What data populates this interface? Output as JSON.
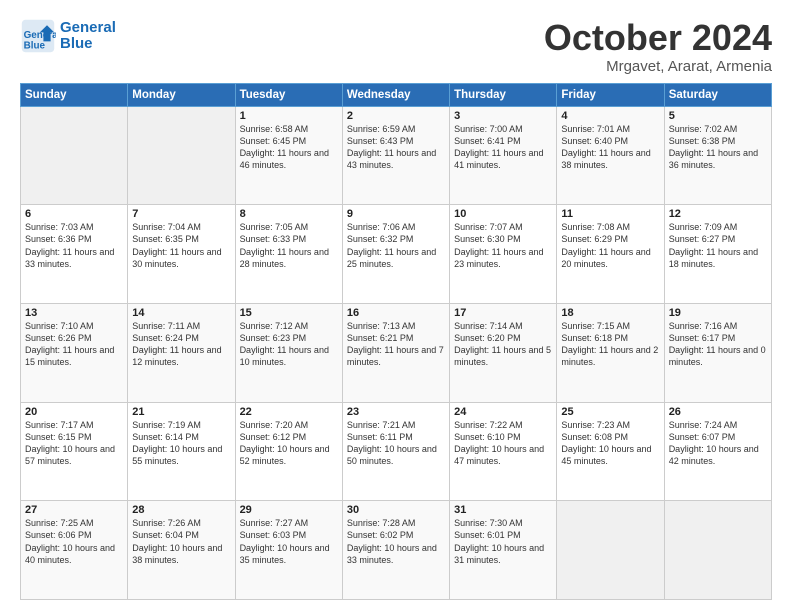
{
  "header": {
    "logo_line1": "General",
    "logo_line2": "Blue",
    "month": "October 2024",
    "location": "Mrgavet, Ararat, Armenia"
  },
  "weekdays": [
    "Sunday",
    "Monday",
    "Tuesday",
    "Wednesday",
    "Thursday",
    "Friday",
    "Saturday"
  ],
  "weeks": [
    [
      {
        "day": "",
        "sunrise": "",
        "sunset": "",
        "daylight": ""
      },
      {
        "day": "",
        "sunrise": "",
        "sunset": "",
        "daylight": ""
      },
      {
        "day": "1",
        "sunrise": "Sunrise: 6:58 AM",
        "sunset": "Sunset: 6:45 PM",
        "daylight": "Daylight: 11 hours and 46 minutes."
      },
      {
        "day": "2",
        "sunrise": "Sunrise: 6:59 AM",
        "sunset": "Sunset: 6:43 PM",
        "daylight": "Daylight: 11 hours and 43 minutes."
      },
      {
        "day": "3",
        "sunrise": "Sunrise: 7:00 AM",
        "sunset": "Sunset: 6:41 PM",
        "daylight": "Daylight: 11 hours and 41 minutes."
      },
      {
        "day": "4",
        "sunrise": "Sunrise: 7:01 AM",
        "sunset": "Sunset: 6:40 PM",
        "daylight": "Daylight: 11 hours and 38 minutes."
      },
      {
        "day": "5",
        "sunrise": "Sunrise: 7:02 AM",
        "sunset": "Sunset: 6:38 PM",
        "daylight": "Daylight: 11 hours and 36 minutes."
      }
    ],
    [
      {
        "day": "6",
        "sunrise": "Sunrise: 7:03 AM",
        "sunset": "Sunset: 6:36 PM",
        "daylight": "Daylight: 11 hours and 33 minutes."
      },
      {
        "day": "7",
        "sunrise": "Sunrise: 7:04 AM",
        "sunset": "Sunset: 6:35 PM",
        "daylight": "Daylight: 11 hours and 30 minutes."
      },
      {
        "day": "8",
        "sunrise": "Sunrise: 7:05 AM",
        "sunset": "Sunset: 6:33 PM",
        "daylight": "Daylight: 11 hours and 28 minutes."
      },
      {
        "day": "9",
        "sunrise": "Sunrise: 7:06 AM",
        "sunset": "Sunset: 6:32 PM",
        "daylight": "Daylight: 11 hours and 25 minutes."
      },
      {
        "day": "10",
        "sunrise": "Sunrise: 7:07 AM",
        "sunset": "Sunset: 6:30 PM",
        "daylight": "Daylight: 11 hours and 23 minutes."
      },
      {
        "day": "11",
        "sunrise": "Sunrise: 7:08 AM",
        "sunset": "Sunset: 6:29 PM",
        "daylight": "Daylight: 11 hours and 20 minutes."
      },
      {
        "day": "12",
        "sunrise": "Sunrise: 7:09 AM",
        "sunset": "Sunset: 6:27 PM",
        "daylight": "Daylight: 11 hours and 18 minutes."
      }
    ],
    [
      {
        "day": "13",
        "sunrise": "Sunrise: 7:10 AM",
        "sunset": "Sunset: 6:26 PM",
        "daylight": "Daylight: 11 hours and 15 minutes."
      },
      {
        "day": "14",
        "sunrise": "Sunrise: 7:11 AM",
        "sunset": "Sunset: 6:24 PM",
        "daylight": "Daylight: 11 hours and 12 minutes."
      },
      {
        "day": "15",
        "sunrise": "Sunrise: 7:12 AM",
        "sunset": "Sunset: 6:23 PM",
        "daylight": "Daylight: 11 hours and 10 minutes."
      },
      {
        "day": "16",
        "sunrise": "Sunrise: 7:13 AM",
        "sunset": "Sunset: 6:21 PM",
        "daylight": "Daylight: 11 hours and 7 minutes."
      },
      {
        "day": "17",
        "sunrise": "Sunrise: 7:14 AM",
        "sunset": "Sunset: 6:20 PM",
        "daylight": "Daylight: 11 hours and 5 minutes."
      },
      {
        "day": "18",
        "sunrise": "Sunrise: 7:15 AM",
        "sunset": "Sunset: 6:18 PM",
        "daylight": "Daylight: 11 hours and 2 minutes."
      },
      {
        "day": "19",
        "sunrise": "Sunrise: 7:16 AM",
        "sunset": "Sunset: 6:17 PM",
        "daylight": "Daylight: 11 hours and 0 minutes."
      }
    ],
    [
      {
        "day": "20",
        "sunrise": "Sunrise: 7:17 AM",
        "sunset": "Sunset: 6:15 PM",
        "daylight": "Daylight: 10 hours and 57 minutes."
      },
      {
        "day": "21",
        "sunrise": "Sunrise: 7:19 AM",
        "sunset": "Sunset: 6:14 PM",
        "daylight": "Daylight: 10 hours and 55 minutes."
      },
      {
        "day": "22",
        "sunrise": "Sunrise: 7:20 AM",
        "sunset": "Sunset: 6:12 PM",
        "daylight": "Daylight: 10 hours and 52 minutes."
      },
      {
        "day": "23",
        "sunrise": "Sunrise: 7:21 AM",
        "sunset": "Sunset: 6:11 PM",
        "daylight": "Daylight: 10 hours and 50 minutes."
      },
      {
        "day": "24",
        "sunrise": "Sunrise: 7:22 AM",
        "sunset": "Sunset: 6:10 PM",
        "daylight": "Daylight: 10 hours and 47 minutes."
      },
      {
        "day": "25",
        "sunrise": "Sunrise: 7:23 AM",
        "sunset": "Sunset: 6:08 PM",
        "daylight": "Daylight: 10 hours and 45 minutes."
      },
      {
        "day": "26",
        "sunrise": "Sunrise: 7:24 AM",
        "sunset": "Sunset: 6:07 PM",
        "daylight": "Daylight: 10 hours and 42 minutes."
      }
    ],
    [
      {
        "day": "27",
        "sunrise": "Sunrise: 7:25 AM",
        "sunset": "Sunset: 6:06 PM",
        "daylight": "Daylight: 10 hours and 40 minutes."
      },
      {
        "day": "28",
        "sunrise": "Sunrise: 7:26 AM",
        "sunset": "Sunset: 6:04 PM",
        "daylight": "Daylight: 10 hours and 38 minutes."
      },
      {
        "day": "29",
        "sunrise": "Sunrise: 7:27 AM",
        "sunset": "Sunset: 6:03 PM",
        "daylight": "Daylight: 10 hours and 35 minutes."
      },
      {
        "day": "30",
        "sunrise": "Sunrise: 7:28 AM",
        "sunset": "Sunset: 6:02 PM",
        "daylight": "Daylight: 10 hours and 33 minutes."
      },
      {
        "day": "31",
        "sunrise": "Sunrise: 7:30 AM",
        "sunset": "Sunset: 6:01 PM",
        "daylight": "Daylight: 10 hours and 31 minutes."
      },
      {
        "day": "",
        "sunrise": "",
        "sunset": "",
        "daylight": ""
      },
      {
        "day": "",
        "sunrise": "",
        "sunset": "",
        "daylight": ""
      }
    ]
  ]
}
